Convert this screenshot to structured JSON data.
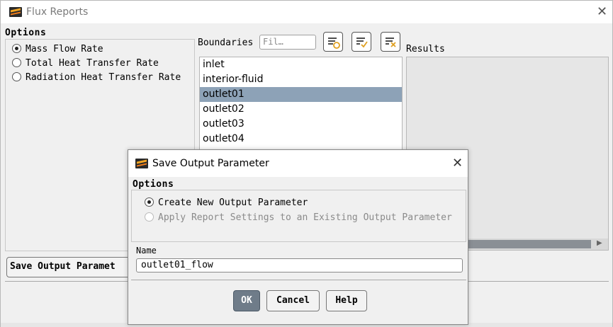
{
  "window": {
    "title": "Flux Reports",
    "close_symbol": "✕"
  },
  "options": {
    "label": "Options",
    "radios": [
      {
        "label": "Mass Flow Rate",
        "selected": true
      },
      {
        "label": "Total Heat Transfer Rate",
        "selected": false
      },
      {
        "label": "Radiation Heat Transfer Rate",
        "selected": false
      }
    ]
  },
  "boundaries": {
    "label": "Boundaries",
    "filter_placeholder": "Fil…",
    "items": [
      "inlet",
      "interior-fluid",
      "outlet01",
      "outlet02",
      "outlet03",
      "outlet04"
    ],
    "selected": "outlet01"
  },
  "results": {
    "label": "Results"
  },
  "bottom": {
    "save_output_label": "Save Output Paramet"
  },
  "dialog": {
    "title": "Save Output Parameter",
    "close_symbol": "✕",
    "options_label": "Options",
    "radios": [
      {
        "label": "Create New Output Parameter",
        "selected": true,
        "enabled": true
      },
      {
        "label": "Apply Report Settings to an Existing Output Parameter",
        "selected": false,
        "enabled": false
      }
    ],
    "name_label": "Name",
    "name_value": "outlet01_flow",
    "buttons": {
      "ok": "OK",
      "cancel": "Cancel",
      "help": "Help"
    }
  },
  "colors": {
    "selection": "#8da2b7",
    "ok_button": "#6f7c89",
    "results_bg": "#e6e6e6",
    "scrollbar": "#8a8f95"
  }
}
